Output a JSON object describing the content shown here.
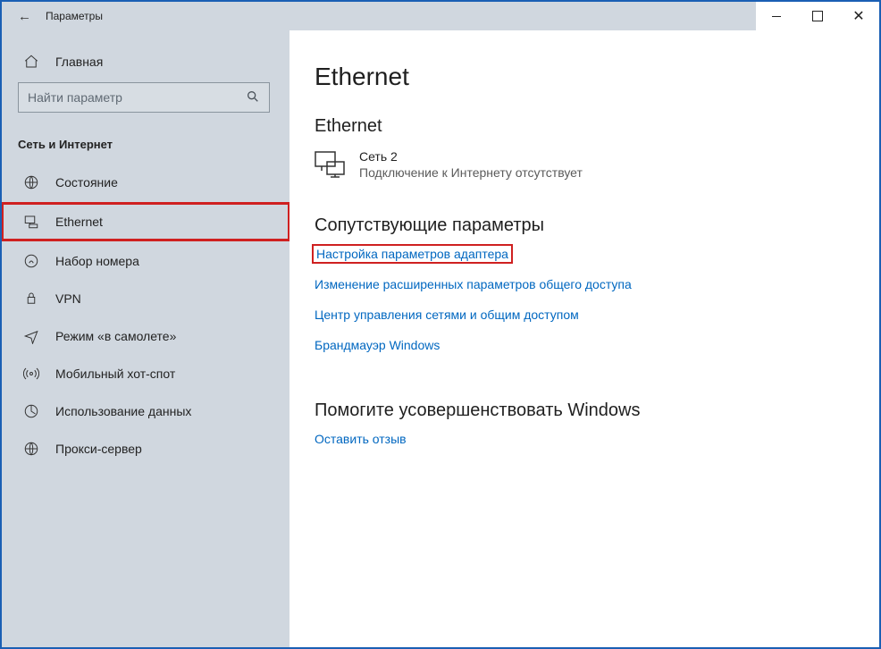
{
  "window": {
    "title": "Параметры"
  },
  "sidebar": {
    "home": "Главная",
    "search_placeholder": "Найти параметр",
    "category": "Сеть и Интернет",
    "items": [
      {
        "label": "Состояние"
      },
      {
        "label": "Ethernet"
      },
      {
        "label": "Набор номера"
      },
      {
        "label": "VPN"
      },
      {
        "label": "Режим «в самолете»"
      },
      {
        "label": "Мобильный хот-спот"
      },
      {
        "label": "Использование данных"
      },
      {
        "label": "Прокси-сервер"
      }
    ]
  },
  "main": {
    "title": "Ethernet",
    "subtitle": "Ethernet",
    "network": {
      "name": "Сеть  2",
      "status": "Подключение к Интернету отсутствует"
    },
    "related": {
      "heading": "Сопутствующие параметры",
      "links": [
        "Настройка параметров адаптера",
        "Изменение расширенных параметров общего доступа",
        "Центр управления сетями и общим доступом",
        "Брандмауэр Windows"
      ]
    },
    "feedback": {
      "heading": "Помогите усовершенствовать Windows",
      "link": "Оставить отзыв"
    }
  }
}
